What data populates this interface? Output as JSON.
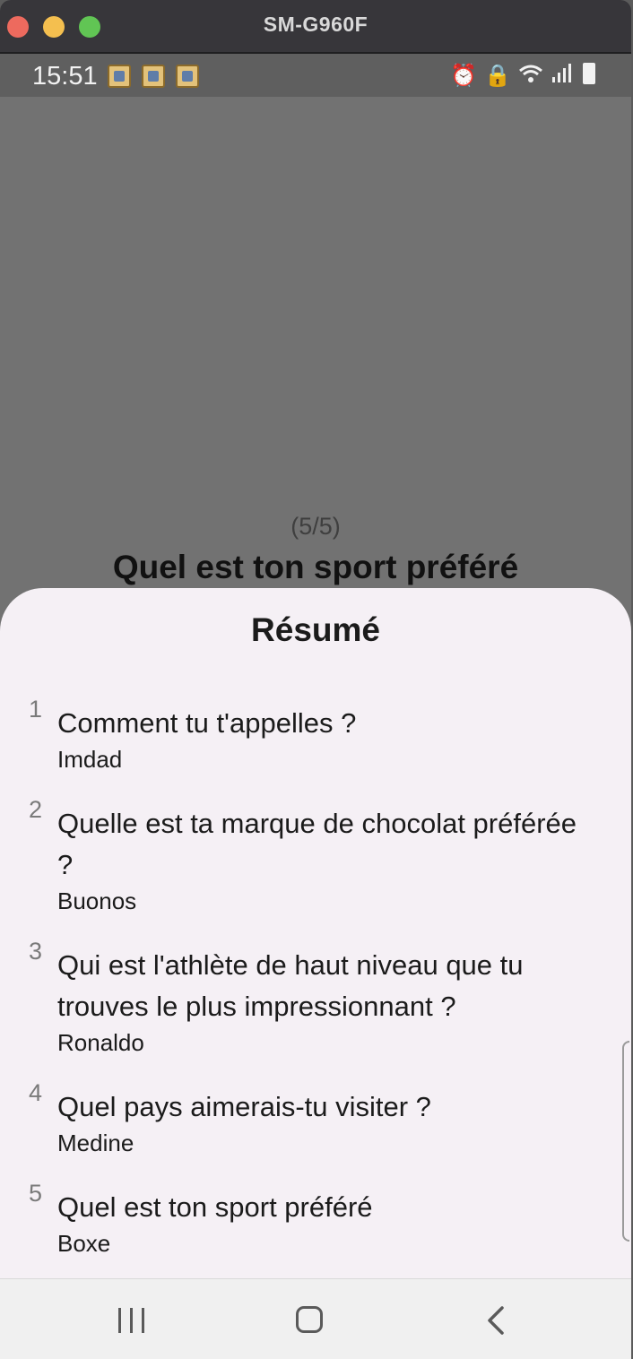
{
  "window": {
    "title": "SM-G960F"
  },
  "status_bar": {
    "time": "15:51",
    "icons": [
      "notification-icon",
      "notification-icon",
      "notification-icon",
      "alarm-icon",
      "lock-icon",
      "wifi-icon",
      "signal-icon",
      "battery-icon"
    ]
  },
  "background_screen": {
    "counter": "(5/5)",
    "question": "Quel est ton sport préféré"
  },
  "summary": {
    "title": "Résumé",
    "items": [
      {
        "number": "1",
        "question": "Comment tu t'appelles ?",
        "answer": "Imdad"
      },
      {
        "number": "2",
        "question": "Quelle est ta marque de chocolat préférée ?",
        "answer": "Buonos"
      },
      {
        "number": "3",
        "question": "Qui est l'athlète de haut niveau que tu trouves le plus impressionnant ?",
        "answer": "Ronaldo"
      },
      {
        "number": "4",
        "question": "Quel pays aimerais-tu visiter ?",
        "answer": "Medine"
      },
      {
        "number": "5",
        "question": "Quel est ton sport préféré",
        "answer": "Boxe"
      }
    ]
  },
  "nav_bar": {
    "buttons": [
      "recents-icon",
      "home-icon",
      "back-icon"
    ]
  }
}
